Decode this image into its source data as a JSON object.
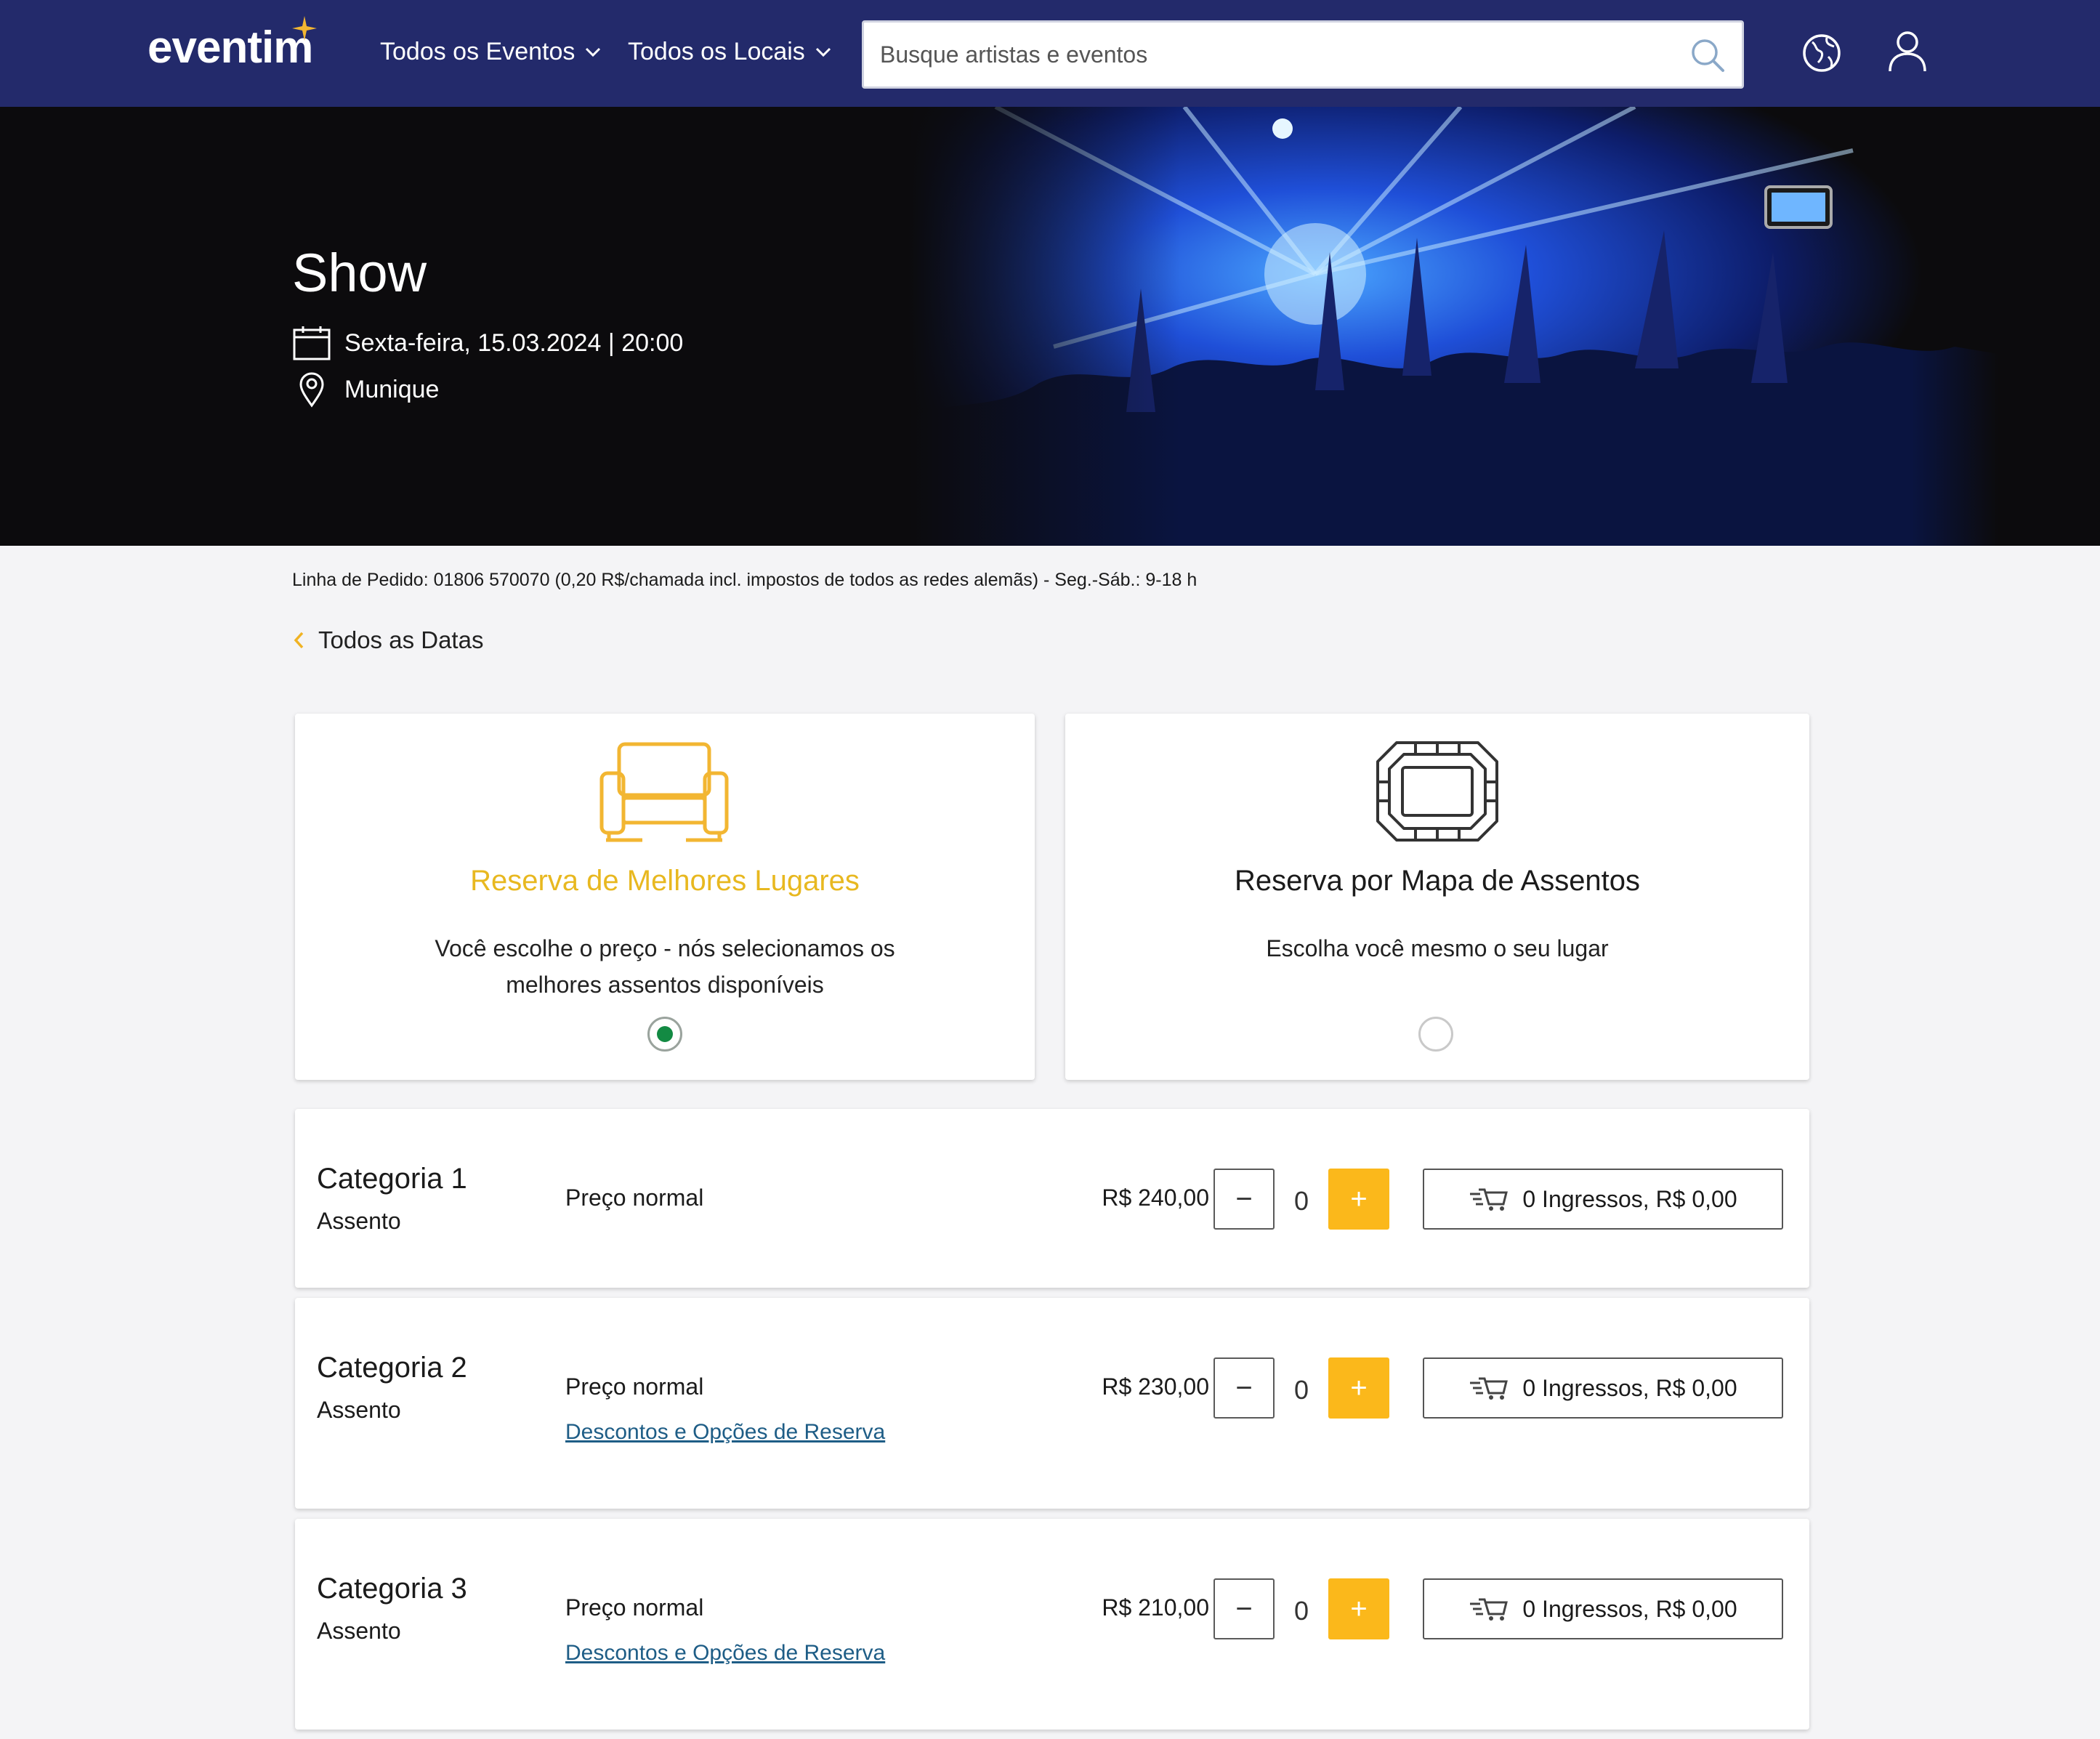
{
  "header": {
    "logo": "eventim",
    "nav": [
      {
        "label": "Todos os Eventos"
      },
      {
        "label": "Todos os Locais"
      }
    ],
    "search_placeholder": "Busque artistas e eventos"
  },
  "event": {
    "title": "Show",
    "datetime": "Sexta-feira, 15.03.2024 | 20:00",
    "location": "Munique"
  },
  "hotline": "Linha de Pedido: 01806 570070 (0,20 R$/chamada incl. impostos de todos as redes alemãs) - Seg.-Sáb.: 9-18 h",
  "back_label": "Todos as Datas",
  "booking_options": [
    {
      "title": "Reserva de Melhores Lugares",
      "description": "Você escolhe o preço - nós selecionamos os melhores assentos disponíveis",
      "selected": true,
      "title_color": "#e8b820"
    },
    {
      "title": "Reserva por Mapa de Assentos",
      "description": "Escolha você mesmo o seu lugar",
      "selected": false,
      "title_color": "#1b1b1b"
    }
  ],
  "categories": [
    {
      "name": "Categoria 1",
      "type": "Assento",
      "price_type": "Preço normal",
      "discount_link": "",
      "price": "R$ 240,00",
      "quantity": "0",
      "cart_label": "0 Ingressos, R$ 0,00"
    },
    {
      "name": "Categoria 2",
      "type": "Assento",
      "price_type": "Preço normal",
      "discount_link": "Descontos e Opções de Reserva",
      "price": "R$ 230,00",
      "quantity": "0",
      "cart_label": "0 Ingressos, R$ 0,00"
    },
    {
      "name": "Categoria 3",
      "type": "Assento",
      "price_type": "Preço normal",
      "discount_link": "Descontos e Opções de Reserva",
      "price": "R$ 210,00",
      "quantity": "0",
      "cart_label": "0 Ingressos, R$ 0,00"
    }
  ],
  "stepper": {
    "minus": "−",
    "plus": "+"
  },
  "colors": {
    "header_bg": "#232a6b",
    "accent_yellow": "#fbb81b",
    "radio_selected": "#138a43",
    "link": "#1e5d86"
  }
}
